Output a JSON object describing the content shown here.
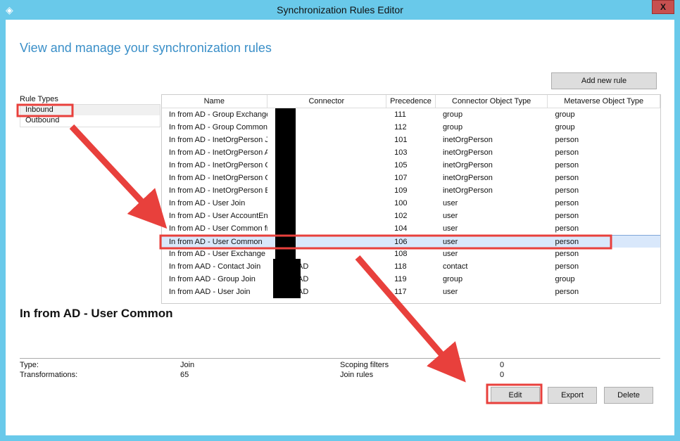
{
  "window": {
    "title": "Synchronization Rules Editor",
    "close_label": "X",
    "icon": "sync-app-icon"
  },
  "heading": "View and manage your synchronization rules",
  "add_rule_label": "Add new rule",
  "rule_types": {
    "label": "Rule Types",
    "items": [
      "Inbound",
      "Outbound"
    ],
    "selected": "Inbound"
  },
  "table": {
    "columns": [
      "Name",
      "Connector",
      "Precedence",
      "Connector Object Type",
      "Metaverse Object Type"
    ],
    "rows": [
      [
        "In from AD - Group Exchange",
        "",
        "111",
        "group",
        "group"
      ],
      [
        "In from AD - Group Common",
        "",
        "112",
        "group",
        "group"
      ],
      [
        "In from AD - InetOrgPerson Jo",
        "",
        "101",
        "inetOrgPerson",
        "person"
      ],
      [
        "In from AD - InetOrgPerson A",
        "",
        "103",
        "inetOrgPerson",
        "person"
      ],
      [
        "In from AD - InetOrgPerson C",
        "",
        "105",
        "inetOrgPerson",
        "person"
      ],
      [
        "In from AD - InetOrgPerson C",
        "",
        "107",
        "inetOrgPerson",
        "person"
      ],
      [
        "In from AD - InetOrgPerson Ex",
        "",
        "109",
        "inetOrgPerson",
        "person"
      ],
      [
        "In from AD - User Join",
        "",
        "100",
        "user",
        "person"
      ],
      [
        "In from AD - User AccountEna",
        "",
        "102",
        "user",
        "person"
      ],
      [
        "In from AD - User Common fr",
        "",
        "104",
        "user",
        "person"
      ],
      [
        "In from AD - User Common",
        "",
        "106",
        "user",
        "person"
      ],
      [
        "In from AD - User Exchange",
        "",
        "108",
        "user",
        "person"
      ],
      [
        "In from AAD - Contact Join",
        "- AAD",
        "118",
        "contact",
        "person"
      ],
      [
        "In from AAD - Group Join",
        "- AAD",
        "119",
        "group",
        "group"
      ],
      [
        "In from AAD - User Join",
        "- AAD",
        "117",
        "user",
        "person"
      ]
    ],
    "selected_row": 10
  },
  "details": {
    "title": "In from AD - User Common",
    "type_label": "Type:",
    "type_value": "Join",
    "transformations_label": "Transformations:",
    "transformations_value": "65",
    "scoping_label": "Scoping filters",
    "scoping_value": "0",
    "join_label": "Join rules",
    "join_value": "0"
  },
  "buttons": {
    "edit": "Edit",
    "export": "Export",
    "delete": "Delete"
  },
  "colors": {
    "frame": "#69c9ea",
    "heading": "#3a8fc8",
    "annotation": "#e8403c",
    "selection": "#d9e8fb"
  }
}
